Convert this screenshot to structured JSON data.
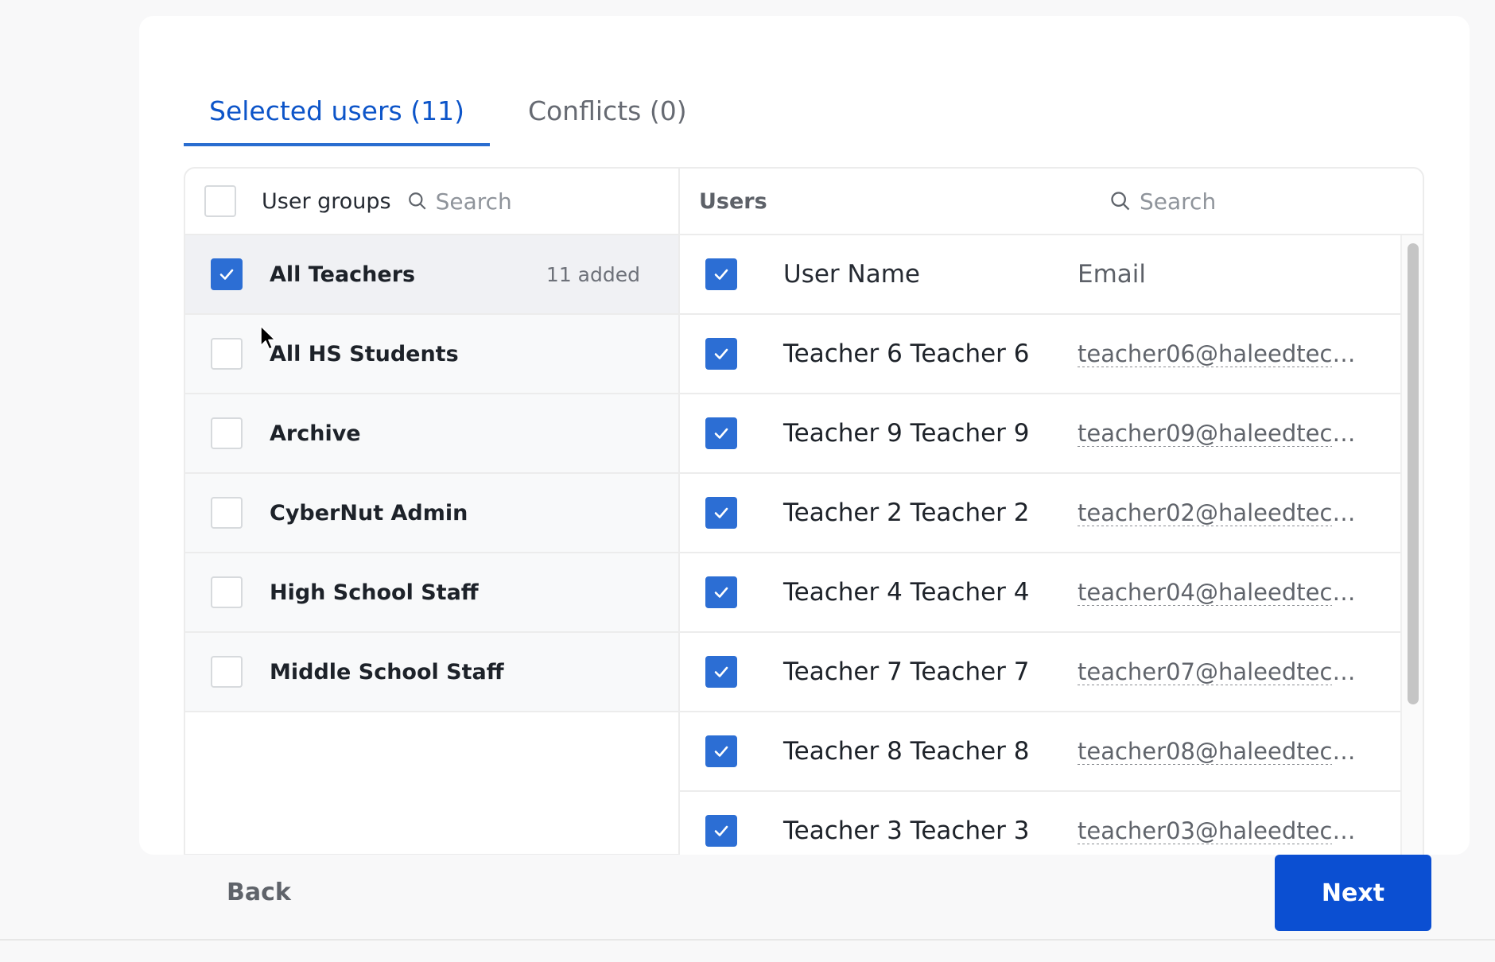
{
  "tabs": [
    {
      "label": "Selected users (11)",
      "active": true
    },
    {
      "label": "Conflicts (0)",
      "active": false
    }
  ],
  "groups_header": {
    "title": "User groups",
    "search_placeholder": "Search"
  },
  "users_header": {
    "title": "Users",
    "search_placeholder": "Search"
  },
  "groups": [
    {
      "name": "All Teachers",
      "checked": true,
      "count": "11 added"
    },
    {
      "name": "All HS Students",
      "checked": false
    },
    {
      "name": "Archive",
      "checked": false
    },
    {
      "name": "CyberNut Admin",
      "checked": false
    },
    {
      "name": "High School Staff",
      "checked": false
    },
    {
      "name": "Middle School Staff",
      "checked": false
    }
  ],
  "users_table": {
    "col_name": "User Name",
    "col_email": "Email",
    "rows": [
      {
        "name": "Teacher 6 Teacher 6",
        "email": "teacher06@haleedtech...",
        "checked": true
      },
      {
        "name": "Teacher 9 Teacher 9",
        "email": "teacher09@haleedtech...",
        "checked": true
      },
      {
        "name": "Teacher 2 Teacher 2",
        "email": "teacher02@haleedtech...",
        "checked": true
      },
      {
        "name": "Teacher 4 Teacher 4",
        "email": "teacher04@haleedtech...",
        "checked": true
      },
      {
        "name": "Teacher 7 Teacher 7",
        "email": "teacher07@haleedtech...",
        "checked": true
      },
      {
        "name": "Teacher 8 Teacher 8",
        "email": "teacher08@haleedtech...",
        "checked": true
      },
      {
        "name": "Teacher 3 Teacher 3",
        "email": "teacher03@haleedtech...",
        "checked": true
      }
    ]
  },
  "footer": {
    "back_label": "Back",
    "next_label": "Next"
  },
  "colors": {
    "accent": "#0b4fd2",
    "checkbox": "#2c6ed4",
    "tab_active": "#0d55c9"
  }
}
